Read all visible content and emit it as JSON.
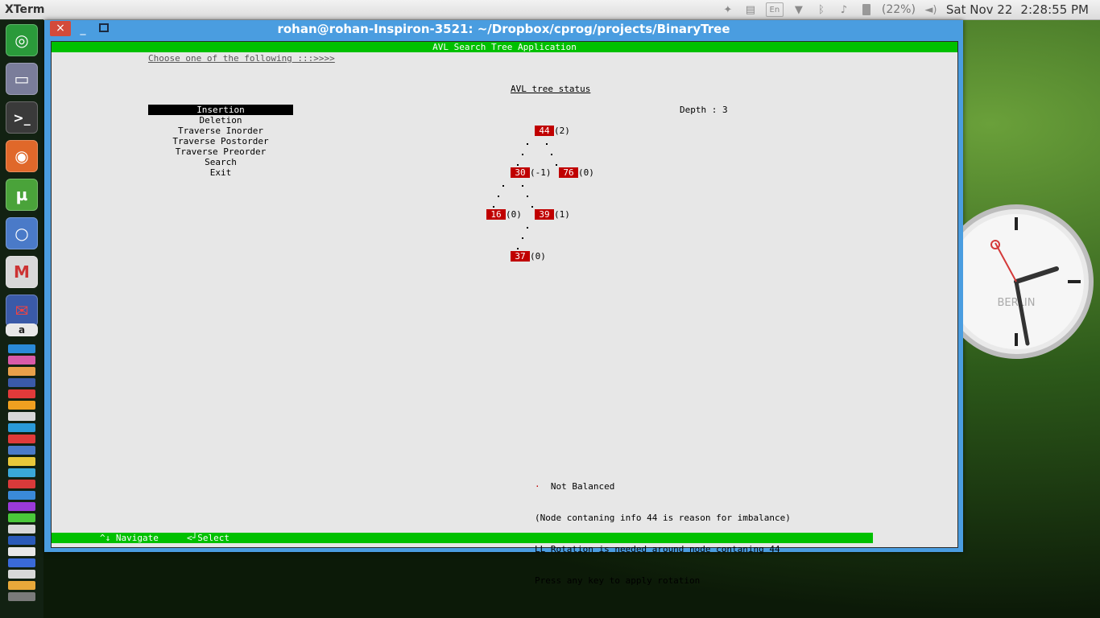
{
  "top_panel": {
    "app_name": "XTerm",
    "battery": "(22%)",
    "date": "Sat Nov 22",
    "time": "2:28:55 PM",
    "keyboard_layout": "En"
  },
  "window": {
    "title": "rohan@rohan-Inspiron-3521: ~/Dropbox/cprog/projects/BinaryTree",
    "close_glyph": "×",
    "minimize_glyph": "_"
  },
  "terminal": {
    "header": "AVL Search Tree Application",
    "prompt": "Choose one of the following :::>>>>",
    "menu": [
      {
        "label": "Insertion",
        "selected": true
      },
      {
        "label": "Deletion",
        "selected": false
      },
      {
        "label": "Traverse Inorder",
        "selected": false
      },
      {
        "label": "Traverse Postorder",
        "selected": false
      },
      {
        "label": "Traverse Preorder",
        "selected": false
      },
      {
        "label": "Search",
        "selected": false
      },
      {
        "label": "Exit",
        "selected": false
      }
    ],
    "tree_title": "AVL tree status",
    "depth": "Depth : 3",
    "nodes": [
      {
        "key": "44",
        "balance": "(2)"
      },
      {
        "key": "30",
        "balance": "(-1)"
      },
      {
        "key": "76",
        "balance": "(0)"
      },
      {
        "key": "16",
        "balance": "(0)"
      },
      {
        "key": "39",
        "balance": "(1)"
      },
      {
        "key": "37",
        "balance": "(0)"
      }
    ],
    "status": {
      "marker": "·",
      "line1": "Not Balanced",
      "line2": "(Node contaning info 44 is reason for imbalance)",
      "line3": "LL Rotation is needed around node contaning 44",
      "line4": "Press any key to apply rotation"
    },
    "footer": {
      "navigate": "^↓ Navigate",
      "select": "<┘Select"
    }
  },
  "clock_widget": {
    "city": "BERLIN"
  },
  "launcher": {
    "icons": [
      "ubuntu-dash-icon",
      "files-icon",
      "terminal-icon",
      "firefox-icon",
      "utorrent-icon",
      "chromium-icon",
      "gmail-icon",
      "mail-icon",
      "amazon-icon"
    ]
  }
}
